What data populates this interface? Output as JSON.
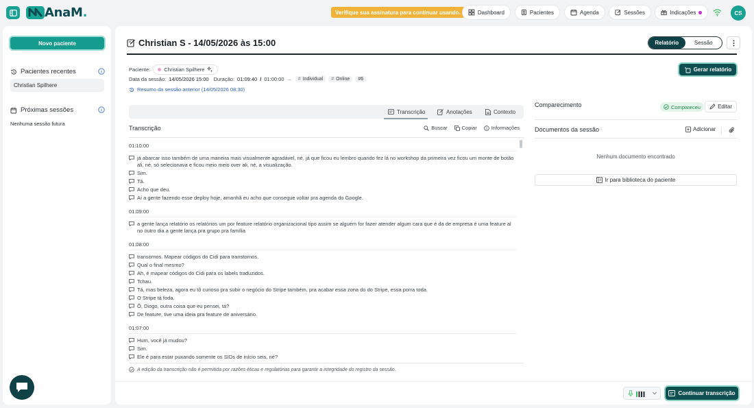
{
  "app": {
    "logo_text": "AnaM",
    "logo_dot": "."
  },
  "topbar": {
    "warning": "Verifique sua assinatura para continuar usando.",
    "nav": [
      {
        "label": "Dashboard",
        "icon": "grid-icon"
      },
      {
        "label": "Pacientes",
        "icon": "patient-card-icon"
      },
      {
        "label": "Agenda",
        "icon": "calendar-icon"
      },
      {
        "label": "Sessões",
        "icon": "session-edit-icon"
      },
      {
        "label": "Indicações",
        "icon": "gift-icon"
      }
    ],
    "avatar_initials": "CS"
  },
  "sidebar": {
    "new_patient": "Novo paciente",
    "recent_title": "Pacientes recentes",
    "recent_items": [
      "Christian Spilhere"
    ],
    "upcoming_title": "Próximas sessões",
    "upcoming_empty": "Nenhuma sessão futura"
  },
  "session": {
    "title": "Christian S - 14/05/2026 às 15:00",
    "view_toggle": {
      "report": "Relatório",
      "session": "Sessão"
    },
    "patient_label": "Paciente:",
    "patient_name": "Christian Spilhere",
    "date_label": "Data da sessão:",
    "date_value": "14/05/2026 15:00",
    "duration_label": "Duração:",
    "duration_value": "01:09:40",
    "duration_sep": "/",
    "duration_total": "01:00:00",
    "tags": [
      "Individual",
      "Online",
      "#6"
    ],
    "previous_summary": "Resumo da sessão anterior (14/05/2026 08:30)",
    "generate_report": "Gerar relatório"
  },
  "tabs": [
    {
      "label": "Transcrição",
      "icon": "transcript-icon"
    },
    {
      "label": "Anotações",
      "icon": "notes-icon"
    },
    {
      "label": "Contexto",
      "icon": "context-icon"
    }
  ],
  "transcript": {
    "title": "Transcrição",
    "tools": {
      "search": "Buscar",
      "copy": "Copiar",
      "info": "Informações"
    },
    "groups": [
      {
        "time": "01:10:00",
        "lines": [
          "já abarcar isso também de uma maneira mais visualmente agradável, né, já que ficou eu lembro quando fez lá no workshop da primeira vez ficou um monte de botão ali, né, só selecionava e ficou meio meio over ali, né, a visualização.",
          "Sim.",
          "Tá.",
          "Acho que deu.",
          "Aí a gente fazendo esse deploy hoje, amanhã eu acho que consegue voltar pra agenda do Google."
        ]
      },
      {
        "time": "01:09:00",
        "lines": [
          "a gente lança relatório os relatórios um por feature relatório organizacional tipo assim se alguém for fazer atender algum cara que é da de empresa é uma feature al no outro dia a gente lança pra grupo pra família"
        ]
      },
      {
        "time": "01:08:00",
        "lines": [
          "transornos. Mapear códigos do Cidi para transtornos.",
          "Qual o final mesmo?",
          "Ah, é mapear códigos do Cidi para os labels traduzidos.",
          "Tchau.",
          "Tá, mas beleza, agora eu tô curioso pra subir o negócio do Stripe também, pra acabar essa zona do do Stripe, essa porra toda.",
          "O Stripe tá foda.",
          "Ô, Diogo, outra coisa que eu pensei, tá?",
          "De feature, tive uma ideia pra feature de aniversário."
        ]
      },
      {
        "time": "01:07:00",
        "lines": [
          "Hum, você já mudou?",
          "Sim.",
          "Ele é para estar puxando somente os SIDs de início seis, né?"
        ]
      }
    ],
    "footnote": "A edição da transcrição não é permitida por razões éticas e regulatórias para garantir a integridade do registro da sessão."
  },
  "attendance": {
    "title": "Comparecimento",
    "status": "Compareceu",
    "edit": "Editar"
  },
  "documents": {
    "title": "Documentos da sessão",
    "add": "Adicionar",
    "empty": "Nenhum documento encontrado",
    "library": "Ir para biblioteca do paciente"
  },
  "footer": {
    "continue": "Continuar transcrição"
  },
  "colors": {
    "brand": "#17a294",
    "brand_dark": "#0f4f51",
    "warning": "#f1b23a",
    "link": "#2f61b8"
  }
}
